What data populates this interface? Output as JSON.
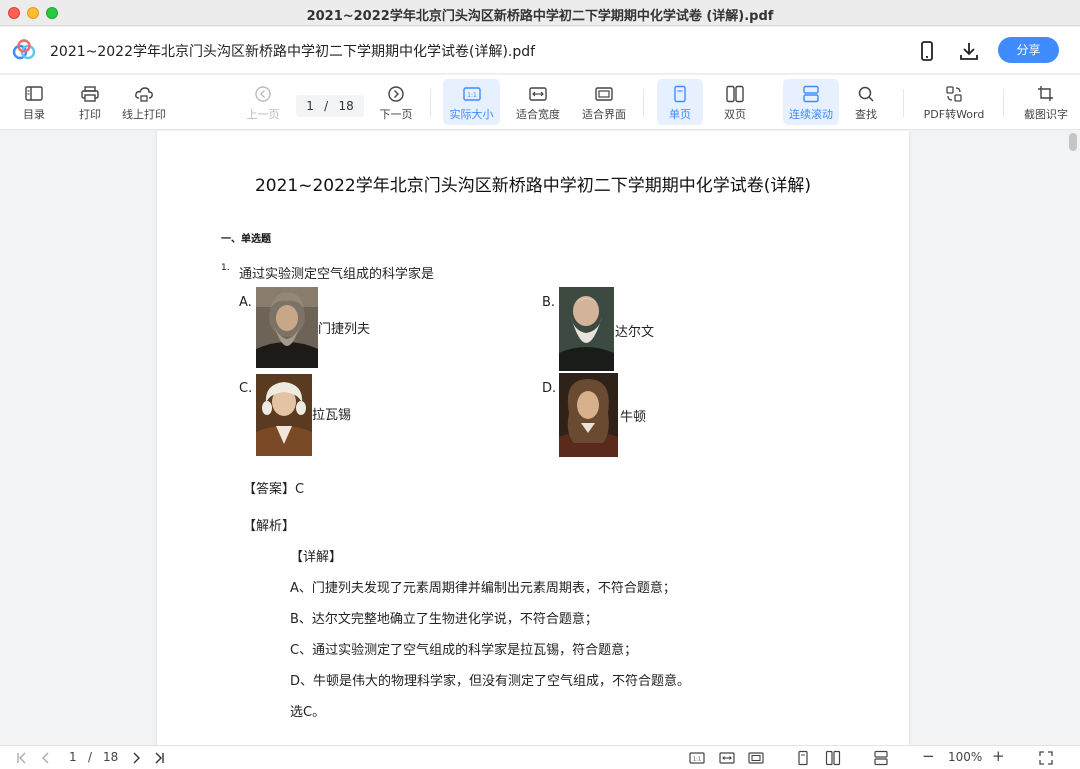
{
  "window": {
    "title": "2021~2022学年北京门头沟区新桥路中学初二下学期期中化学试卷 (详解).pdf"
  },
  "header": {
    "doc_title": "2021~2022学年北京门头沟区新桥路中学初二下学期期中化学试卷(详解).pdf",
    "share_label": "分享"
  },
  "toolbar": {
    "toc": "目录",
    "print": "打印",
    "online_print": "线上打印",
    "prev": "上一页",
    "page_current": "1",
    "page_sep": "/",
    "page_total": "18",
    "next": "下一页",
    "actual_size": "实际大小",
    "fit_width": "适合宽度",
    "fit_page": "适合界面",
    "single": "单页",
    "double": "双页",
    "continuous": "连续滚动",
    "find": "查找",
    "pdf_word": "PDF转Word",
    "ocr": "截图识字",
    "actual_size_badge": "1:1"
  },
  "page": {
    "title": "2021~2022学年北京门头沟区新桥路中学初二下学期期中化学试卷(详解)",
    "section": "一、单选题",
    "q_number": "1.",
    "question": "通过实验测定空气组成的科学家是",
    "options": [
      {
        "letter": "A.",
        "name": "门捷列夫"
      },
      {
        "letter": "B.",
        "name": "达尔文"
      },
      {
        "letter": "C.",
        "name": "拉瓦锡"
      },
      {
        "letter": "D.",
        "name": "牛顿"
      }
    ],
    "answer": "【答案】C",
    "analysis": "【解析】",
    "detail": "【详解】",
    "explanations": [
      "A、门捷列夫发现了元素周期律并编制出元素周期表，不符合题意；",
      "B、达尔文完整地确立了生物进化学说，不符合题意；",
      "C、通过实验测定了空气组成的科学家是拉瓦锡，符合题意；",
      "D、牛顿是伟大的物理科学家，但没有测定了空气组成，不符合题意。",
      "选C。"
    ]
  },
  "status": {
    "page_current": "1",
    "page_sep": "/",
    "page_total": "18",
    "zoom": "100%",
    "minus": "−",
    "plus": "+",
    "actual_badge": "1:1"
  },
  "colors": {
    "accent": "#3f8cff",
    "active_bg": "#e6f0ff"
  }
}
